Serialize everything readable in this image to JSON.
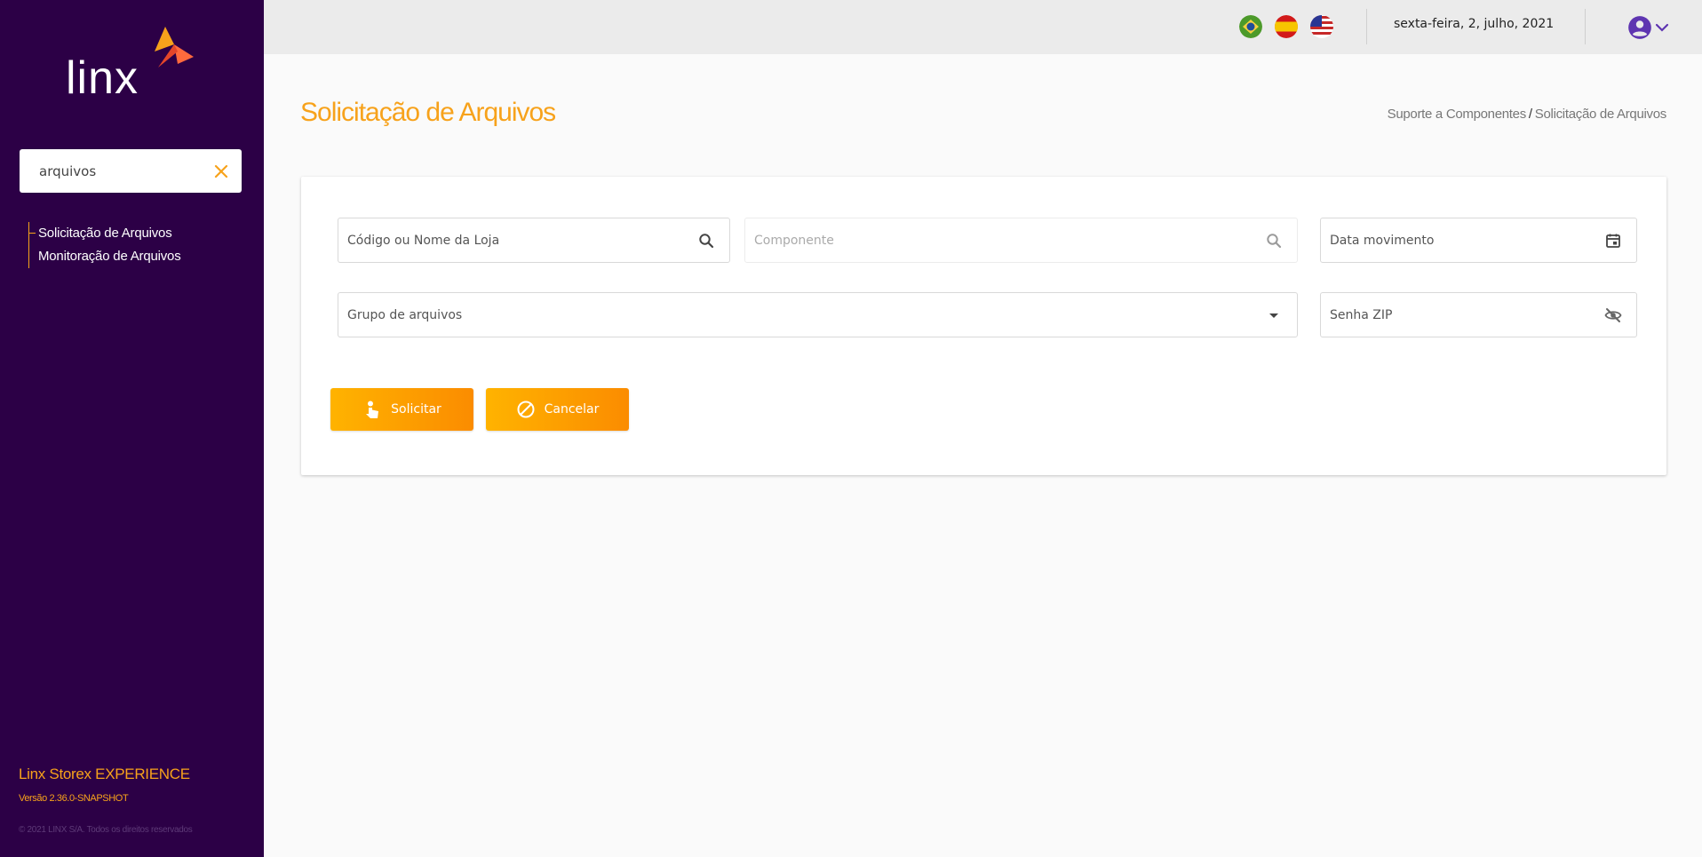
{
  "sidebar": {
    "logo_text": "linx",
    "search": {
      "value": "arquivos",
      "placeholder": ""
    },
    "menu": [
      {
        "label": "Solicitação de Arquivos"
      },
      {
        "label": "Monitoração de Arquivos"
      }
    ],
    "brand": "Linx Storex EXPERIENCE",
    "version": "Versão 2.36.0-SNAPSHOT",
    "copyright": "© 2021 LINX S/A. Todos os direitos reservados"
  },
  "topbar": {
    "flags": [
      "brazil-flag-icon",
      "spain-flag-icon",
      "usa-flag-icon"
    ],
    "date": "sexta-feira, 2, julho, 2021",
    "user_icon": "account-circle-icon"
  },
  "page": {
    "title": "Solicitação de Arquivos",
    "breadcrumb": {
      "parent": "Suporte a Componentes",
      "separator": "/",
      "current": "Solicitação de Arquivos"
    }
  },
  "form": {
    "store": {
      "placeholder": "Código ou Nome da Loja"
    },
    "component": {
      "placeholder": "Componente"
    },
    "date": {
      "placeholder": "Data movimento"
    },
    "file_group": {
      "placeholder": "Grupo de arquivos"
    },
    "zip_password": {
      "placeholder": "Senha ZIP"
    }
  },
  "actions": {
    "submit_label": "Solicitar",
    "cancel_label": "Cancelar"
  },
  "colors": {
    "sidebar_bg": "#2c0046",
    "accent": "#f7a21b",
    "button_gradient_start": "#ffb300",
    "button_gradient_end": "#fb8c00",
    "user_icon": "#5e35b1"
  }
}
